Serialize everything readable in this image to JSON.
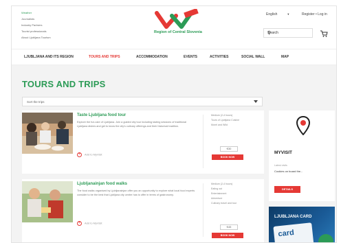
{
  "header": {
    "quick_links": [
      "Weather",
      "Journalists",
      "Industry Partners",
      "Tourist professionals",
      "About Ljubljana Tourism"
    ],
    "logo_text": "Region of Central Slovenia",
    "language": "English",
    "register": "Register",
    "login": "Log in",
    "search_placeholder": "Search"
  },
  "nav": {
    "items": [
      "LJUBLJANA AND ITS REGION",
      "TOURS AND TRIPS",
      "ACCOMMODATION",
      "EVENTS",
      "ACTIVITIES",
      "SOCIAL WALL",
      "MAP"
    ],
    "active_index": 1
  },
  "page": {
    "title": "TOURS AND TRIPS",
    "sort_label": "Sort the trips"
  },
  "tours": [
    {
      "title": "Taste Ljubljana food tour",
      "description": "Explore the fun-size of Ljubljana. Join a guided city tour including tasting sessions of traditional Ljubljana dishes and get to know the city's culinary offerings and their historical tradition.",
      "add_label": "Add to MyVisit",
      "facts": [
        "Medium (2-4 hours)",
        "Tours of Ljubljana Cuisine",
        "Morel and Wild"
      ],
      "price": "€30",
      "book_label": "BOOK NOW"
    },
    {
      "title": "Ljubljanainjan food walks",
      "description": "The food walks organised by Ljubljanainjan offer you an opportunity to explore what local food experts consider to be the best that Ljubljana city centre has to offer in terms of gastronomy.",
      "add_label": "Add to MyVisit",
      "facts": [
        "Medium (2-4 hours)",
        "Eating out",
        "Entertainment",
        "Adventure",
        "Culinary travel and tour"
      ],
      "price": "€45",
      "book_label": "BOOK NOW"
    }
  ],
  "sidebar": {
    "myvisit_title": "MYVISIT",
    "latest_label": "Latest visits",
    "latest_text": "Cookies on board the...",
    "details_label": "DETAILS",
    "card_title": "LJUBLJANA CARD",
    "card_text": "card"
  },
  "colors": {
    "brand_green": "#2c9b56",
    "accent_red": "#e53935"
  }
}
